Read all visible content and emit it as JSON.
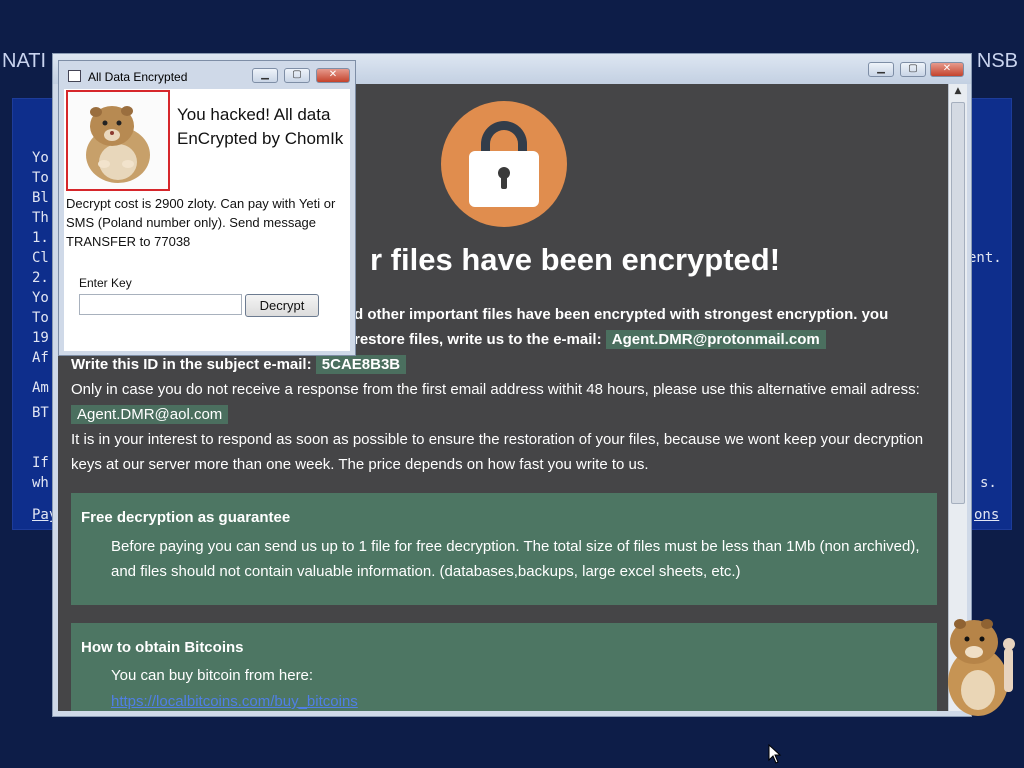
{
  "background_window": {
    "title_left": "NATI",
    "title_right": "NSB",
    "lines": [
      "Yo",
      "To",
      "Bl",
      "Th",
      "1.",
      "Cl",
      "2.",
      "Yo",
      "To",
      "19",
      "Af",
      "Am",
      "BT",
      "If",
      "wh"
    ],
    "right_fragments": [
      "ent.",
      "s."
    ],
    "link_left": "Pay",
    "link_right": "ons"
  },
  "main_window": {
    "headline": "r files have been encrypted!",
    "line1": "d other important files have been encrypted with strongest encryption. you",
    "line2": "restore files, write us to the e-mail:",
    "email_primary": "Agent.DMR@protonmail.com",
    "id_label": "Write this ID in the subject e-mail:",
    "id_value": "5CAE8B3B",
    "alt_line": "Only in case you do not receive a response from the first email address withit 48 hours, please use this alternative email adress:",
    "email_alt": "Agent.DMR@aol.com",
    "interest_line1": "It is in your interest to respond as soon as possible to ensure the restoration of your files, because we wont keep your decryption",
    "interest_line2": "keys at our server more than one week. The price depends on how fast you write to us.",
    "guarantee": {
      "title": "Free decryption as guarantee",
      "line1": "Before paying you can send us up to 1 file for free decryption. The total size of files must be less than 1Mb (non archived),",
      "line2": "and files should not contain valuable information. (databases,backups, large excel sheets, etc.)"
    },
    "bitcoin": {
      "title": "How to obtain Bitcoins",
      "line1": "You can buy bitcoin from here:",
      "link": "https://localbitcoins.com/buy_bitcoins"
    },
    "accent_color": "#e08d4e",
    "panel_color": "#4d7663"
  },
  "dialog": {
    "title": "All Data Encrypted",
    "hacked_line1": "You hacked! All data",
    "hacked_line2": "EnCrypted by ChomIk",
    "cost_text": "Decrypt cost is 2900 zloty. Can pay with Yeti or SMS (Poland number only). Send message TRANSFER to 77038",
    "enter_key_label": "Enter Key",
    "key_value": "",
    "decrypt_button": "Decrypt"
  }
}
